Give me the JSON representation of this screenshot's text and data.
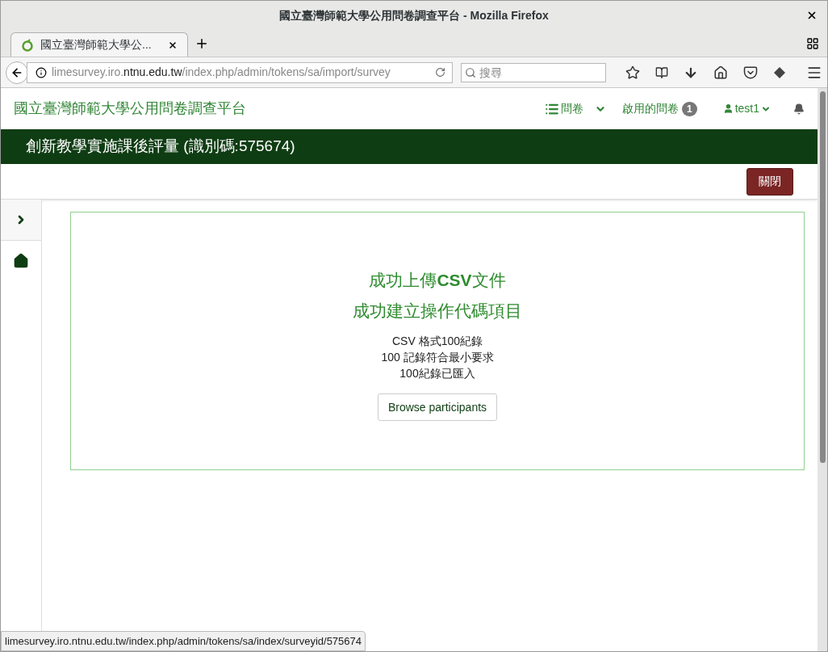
{
  "window": {
    "title": "國立臺灣師範大學公用問卷調查平台 - Mozilla Firefox"
  },
  "tabs": [
    {
      "label": "國立臺灣師範大學公...",
      "selected": true
    }
  ],
  "address_bar": {
    "url_prefix": "limesurvey.iro.",
    "url_domain": "ntnu.edu.tw",
    "url_path": "/index.php/admin/tokens/sa/import/survey"
  },
  "search": {
    "placeholder": "搜尋"
  },
  "navbar": {
    "brand": "國立臺灣師範大學公用問卷調查平台",
    "surveys": "問卷",
    "active_surveys": "啟用的問卷",
    "active_count": "1",
    "user": "test1"
  },
  "survey_bar": {
    "title": "創新教學實施課後評量 (識別碼:575674)"
  },
  "toolbar": {
    "close": "關閉"
  },
  "result": {
    "headings": [
      "成功上傳**CSV**文件",
      "成功建立操作代碼項目"
    ],
    "lines": [
      "CSV 格式100紀錄",
      "100 記錄符合最小要求",
      "100紀錄已匯入"
    ],
    "button": "Browse participants"
  },
  "status_bar": {
    "link": "limesurvey.iro.ntnu.edu.tw/index.php/admin/tokens/sa/index/surveyid/575674"
  }
}
